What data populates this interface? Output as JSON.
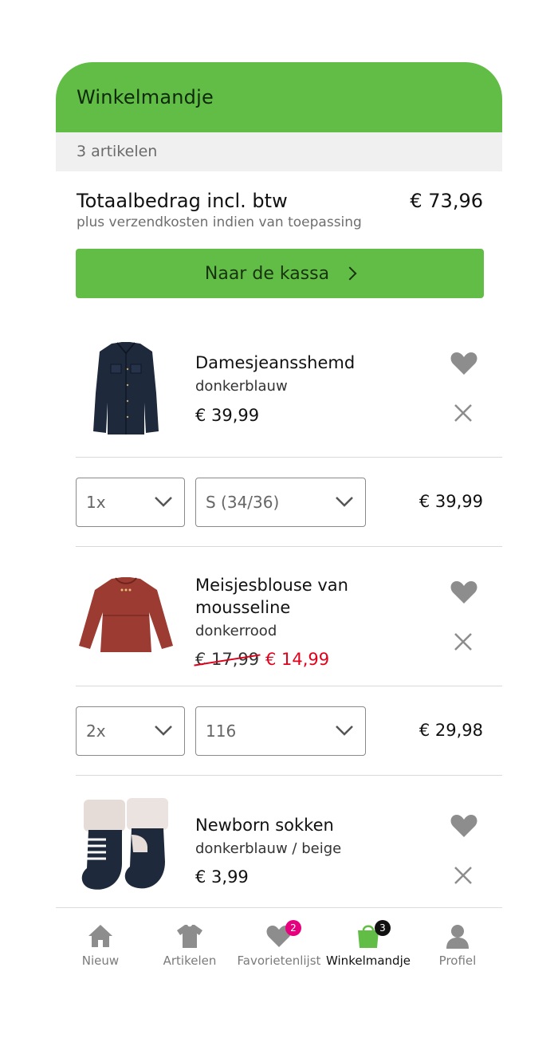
{
  "header": {
    "title": "Winkelmandje"
  },
  "summary": {
    "item_count": "3 artikelen",
    "total_label": "Totaalbedrag incl. btw",
    "total_value": "€ 73,96",
    "shipping_note": "plus verzendkosten indien van toepassing",
    "checkout_label": "Naar de kassa"
  },
  "items": [
    {
      "name": "Damesjeansshemd",
      "color": "donkerblauw",
      "price": "€ 39,99",
      "quantity": "1x",
      "size": "S (34/36)",
      "line_total": "€ 39,99",
      "image_icon": "denim-shirt-image"
    },
    {
      "name": "Meisjesblouse van mousseline",
      "color": "donkerrood",
      "old_price": "€ 17,99",
      "sale_price": "€ 14,99",
      "quantity": "2x",
      "size": "116",
      "line_total": "€ 29,98",
      "image_icon": "girls-blouse-image"
    },
    {
      "name": "Newborn sokken",
      "color": "donkerblauw / beige",
      "price": "€ 3,99",
      "image_icon": "baby-socks-image"
    }
  ],
  "nav": [
    {
      "label": "Nieuw",
      "icon": "home-icon"
    },
    {
      "label": "Artikelen",
      "icon": "tshirt-icon"
    },
    {
      "label": "Favorietenlijst",
      "icon": "heart-icon",
      "badge": "2"
    },
    {
      "label": "Winkelmandje",
      "icon": "shopping-bag-icon",
      "badge": "3",
      "active": true
    },
    {
      "label": "Profiel",
      "icon": "person-icon"
    }
  ],
  "colors": {
    "brand_green": "#62bd46",
    "sale_red": "#e2001a",
    "favorites_badge": "#e6007e",
    "cart_badge": "#111111"
  }
}
